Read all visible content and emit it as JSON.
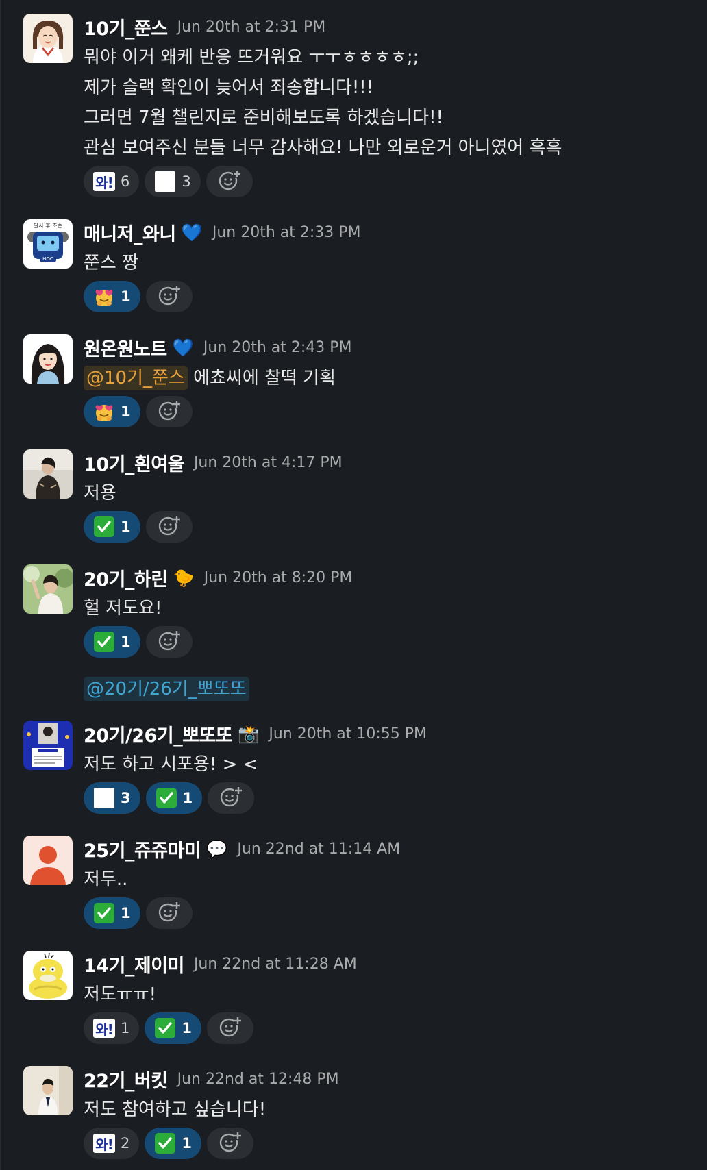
{
  "messages": [
    {
      "name": "10기_쭌스",
      "time": "Jun 20th at 2:31 PM",
      "lines": [
        "뭐야 이거 왜케 반응 뜨거워요 ㅜㅜㅎㅎㅎㅎ;;",
        "제가 슬랙 확인이 늦어서 죄송합니다!!!",
        "그러면 7월 챌린지로 준비해보도록 하겠습니다!!",
        "관심 보여주신 분들 너무 감사해요! 나만 외로운거 아니였어 흑흑"
      ],
      "reactions": [
        {
          "emoji": "wa",
          "count": "6"
        },
        {
          "emoji": "white-square",
          "count": "3"
        }
      ]
    },
    {
      "name": "매니저_와니",
      "status": "💙",
      "time": "Jun 20th at 2:33 PM",
      "lines": [
        "쭌스 짱"
      ],
      "reactions": [
        {
          "emoji": "hugging-heart",
          "count": "1"
        }
      ],
      "avatar_text": "발사 후 조준",
      "avatar_badge": "HOC"
    },
    {
      "name": "원온원노트",
      "status": "💙",
      "time": "Jun 20th at 2:43 PM",
      "mention": "@10기_쭌스",
      "text": "에쵸씨에 찰떡 기획",
      "reactions": [
        {
          "emoji": "hugging-heart",
          "count": "1"
        }
      ]
    },
    {
      "name": "10기_흰여울",
      "time": "Jun 20th at 4:17 PM",
      "lines": [
        "저용"
      ],
      "reactions": [
        {
          "emoji": "check",
          "count": "1"
        }
      ]
    },
    {
      "name": "20기_하린",
      "status": "🐤",
      "time": "Jun 20th at 8:20 PM",
      "lines": [
        "헐 저도요!"
      ],
      "reactions": [
        {
          "emoji": "check",
          "count": "1"
        }
      ],
      "followup_mention": "@20기/26기_뽀또또"
    },
    {
      "name": "20기/26기_뽀또또",
      "status": "📸",
      "time": "Jun 20th at 10:55 PM",
      "lines": [
        "저도 하고 시포용! > <"
      ],
      "reactions": [
        {
          "emoji": "white-square",
          "count": "3"
        },
        {
          "emoji": "check",
          "count": "1"
        }
      ]
    },
    {
      "name": "25기_쥬쥬마미",
      "status": "💬",
      "time": "Jun 22nd at 11:14 AM",
      "lines": [
        "저두.."
      ],
      "reactions": [
        {
          "emoji": "check",
          "count": "1"
        }
      ]
    },
    {
      "name": "14기_제이미",
      "time": "Jun 22nd at 11:28 AM",
      "lines": [
        "저도ㅠㅠ!"
      ],
      "reactions": [
        {
          "emoji": "wa",
          "count": "1"
        },
        {
          "emoji": "check",
          "count": "1"
        }
      ]
    },
    {
      "name": "22기_버킷",
      "time": "Jun 22nd at 12:48 PM",
      "lines": [
        "저도 참여하고 싶습니다!"
      ],
      "reactions": [
        {
          "emoji": "wa",
          "count": "2"
        },
        {
          "emoji": "check",
          "count": "1"
        }
      ]
    }
  ],
  "emoji_labels": {
    "wa": "와!"
  },
  "colors": {
    "background": "#1a1d21",
    "reaction_active": "#144a73",
    "reaction_inactive": "#2b2e33",
    "mention_yellow": "#e8a23b",
    "mention_blue": "#3fa6d4"
  }
}
